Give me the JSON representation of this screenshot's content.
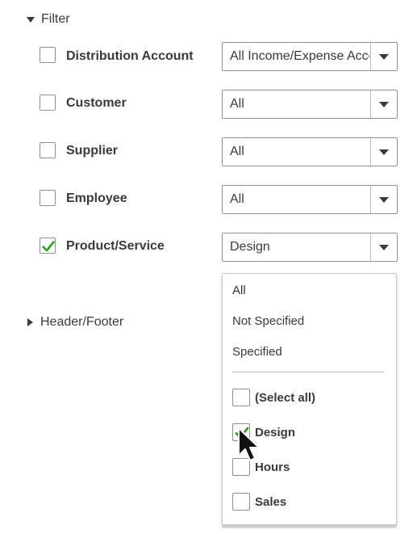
{
  "filter_section": {
    "label": "Filter",
    "expanded": true
  },
  "header_footer_section": {
    "label": "Header/Footer",
    "expanded": false
  },
  "filters": [
    {
      "label": "Distribution Account",
      "checked": false,
      "value": "All Income/Expense Accounts"
    },
    {
      "label": "Customer",
      "checked": false,
      "value": "All"
    },
    {
      "label": "Supplier",
      "checked": false,
      "value": "All"
    },
    {
      "label": "Employee",
      "checked": false,
      "value": "All"
    },
    {
      "label": "Product/Service",
      "checked": true,
      "value": "Design"
    }
  ],
  "dropdown": {
    "options": [
      "All",
      "Not Specified",
      "Specified"
    ],
    "items": [
      {
        "label": "(Select all)",
        "checked": false
      },
      {
        "label": "Design",
        "checked": true
      },
      {
        "label": "Hours",
        "checked": false
      },
      {
        "label": "Sales",
        "checked": false
      }
    ]
  },
  "colors": {
    "check_green": "#2ca01c",
    "text": "#393a3d",
    "border": "#8d9096"
  },
  "icons": {
    "expand": "caret-down-icon",
    "collapse": "caret-right-icon",
    "check": "checkmark-icon",
    "cursor": "mouse-pointer-icon"
  }
}
